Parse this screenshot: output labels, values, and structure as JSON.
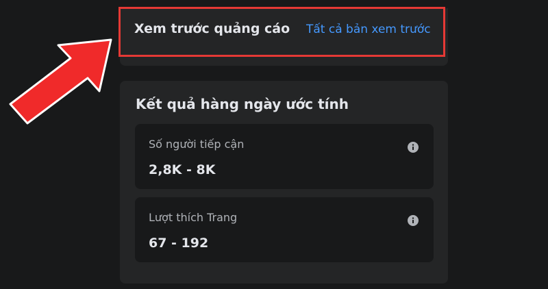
{
  "preview": {
    "title": "Xem trước quảng cáo",
    "link": "Tất cả bản xem trước"
  },
  "results": {
    "title": "Kết quả hàng ngày ước tính",
    "metrics": [
      {
        "label": "Số người tiếp cận",
        "value": "2,8K - 8K"
      },
      {
        "label": "Lượt thích Trang",
        "value": "67 - 192"
      }
    ]
  },
  "colors": {
    "background": "#18191a",
    "card": "#242526",
    "link": "#4599ff",
    "highlight": "#e53935"
  },
  "icons": {
    "info": "info-icon",
    "annotation": "red-arrow"
  }
}
